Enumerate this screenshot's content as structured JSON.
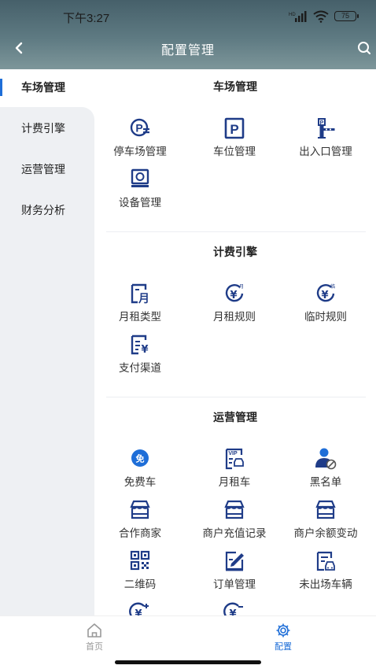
{
  "status_bar": {
    "time": "下午3:27",
    "network": "HD",
    "battery": "75"
  },
  "nav": {
    "title": "配置管理",
    "back_icon": "chevron-left-icon",
    "search_icon": "search-icon"
  },
  "sidebar": {
    "items": [
      {
        "label": "车场管理",
        "active": true
      },
      {
        "label": "计费引擎",
        "active": false
      },
      {
        "label": "运营管理",
        "active": false
      },
      {
        "label": "财务分析",
        "active": false
      }
    ]
  },
  "sections": [
    {
      "title": "车场管理",
      "items": [
        {
          "label": "停车场管理",
          "icon": "parking-lot-icon"
        },
        {
          "label": "车位管理",
          "icon": "parking-space-icon"
        },
        {
          "label": "出入口管理",
          "icon": "gate-barrier-icon"
        },
        {
          "label": "设备管理",
          "icon": "camera-device-icon"
        }
      ]
    },
    {
      "title": "计费引擎",
      "items": [
        {
          "label": "月租类型",
          "icon": "monthly-type-icon",
          "glyph": "月"
        },
        {
          "label": "月租规则",
          "icon": "monthly-rule-icon",
          "glyph": "¥",
          "badge": "月"
        },
        {
          "label": "临时规则",
          "icon": "temporary-rule-icon",
          "glyph": "¥",
          "badge": "临"
        },
        {
          "label": "支付渠道",
          "icon": "payment-channel-icon",
          "glyph": "¥"
        }
      ]
    },
    {
      "title": "运营管理",
      "items": [
        {
          "label": "免费车",
          "icon": "free-car-icon",
          "glyph": "免"
        },
        {
          "label": "月租车",
          "icon": "vip-car-icon",
          "glyph": "VIP"
        },
        {
          "label": "黑名单",
          "icon": "blacklist-user-icon"
        },
        {
          "label": "合作商家",
          "icon": "partner-store-icon"
        },
        {
          "label": "商户充值记录",
          "icon": "merchant-recharge-icon"
        },
        {
          "label": "商户余额变动",
          "icon": "merchant-balance-icon"
        },
        {
          "label": "二维码",
          "icon": "qr-code-icon"
        },
        {
          "label": "订单管理",
          "icon": "order-edit-icon"
        },
        {
          "label": "未出场车辆",
          "icon": "unexited-vehicle-icon"
        },
        {
          "label": "",
          "icon": "yuan-plus-icon",
          "glyph": "¥"
        },
        {
          "label": "",
          "icon": "yuan-minus-icon",
          "glyph": "¥"
        }
      ]
    }
  ],
  "tabbar": {
    "items": [
      {
        "label": "首页",
        "icon": "home-icon",
        "active": false
      },
      {
        "label": "配置",
        "icon": "settings-gear-icon",
        "active": true
      }
    ]
  },
  "colors": {
    "accent": "#1e6ed8",
    "header_top": "#46606a",
    "header_bottom": "#7d969a",
    "sidebar_bg": "#eef0f3",
    "icon_dark": "#1f3c88",
    "text": "#222222",
    "inactive_tab": "#999999"
  }
}
